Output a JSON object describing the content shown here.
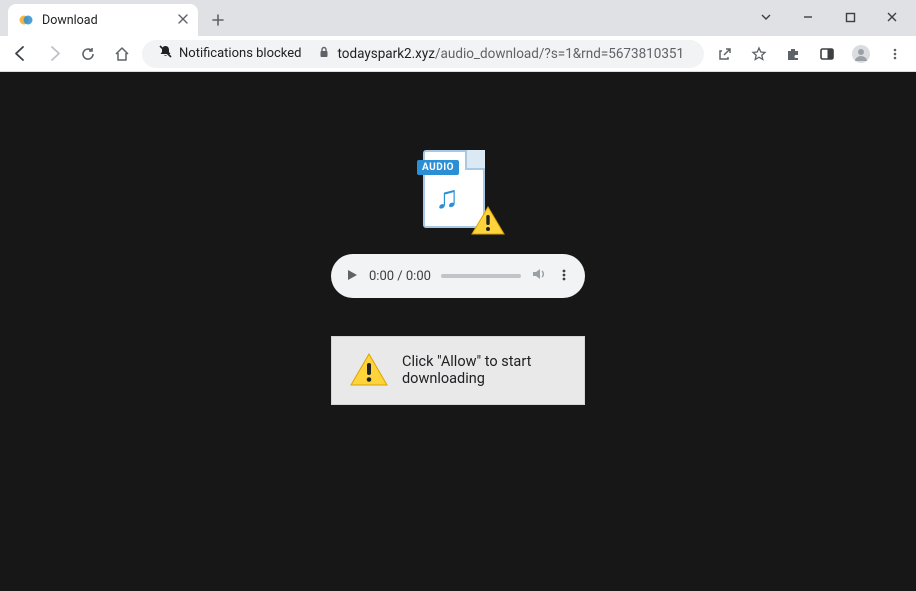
{
  "tab": {
    "title": "Download"
  },
  "notif_chip": "Notifications blocked",
  "url": {
    "host": "todayspark2.xyz",
    "path": "/audio_download/?s=1&rnd=5673810351"
  },
  "audio_badge": "AUDIO",
  "player": {
    "time": "0:00 / 0:00"
  },
  "alert": {
    "text": "Click \"Allow\" to start downloading"
  }
}
